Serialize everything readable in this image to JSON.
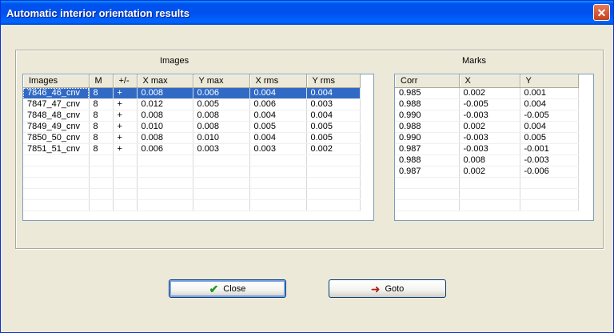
{
  "window": {
    "title": "Automatic interior orientation results",
    "close_glyph": "✕"
  },
  "images_panel": {
    "label": "Images",
    "columns": [
      "Images",
      "M",
      "+/-",
      "X max",
      "Y max",
      "X rms",
      "Y rms"
    ],
    "rows": [
      [
        "7846_46_cnv",
        "8",
        "+",
        "0.008",
        "0.006",
        "0.004",
        "0.004"
      ],
      [
        "7847_47_cnv",
        "8",
        "+",
        "0.012",
        "0.005",
        "0.006",
        "0.003"
      ],
      [
        "7848_48_cnv",
        "8",
        "+",
        "0.008",
        "0.008",
        "0.004",
        "0.004"
      ],
      [
        "7849_49_cnv",
        "8",
        "+",
        "0.010",
        "0.008",
        "0.005",
        "0.005"
      ],
      [
        "7850_50_cnv",
        "8",
        "+",
        "0.008",
        "0.010",
        "0.004",
        "0.005"
      ],
      [
        "7851_51_cnv",
        "8",
        "+",
        "0.006",
        "0.003",
        "0.003",
        "0.002"
      ]
    ],
    "selected_row": 0
  },
  "marks_panel": {
    "label": "Marks",
    "columns": [
      "Corr",
      "X",
      "Y"
    ],
    "rows": [
      [
        "0.985",
        "0.002",
        "0.001"
      ],
      [
        "0.988",
        "-0.005",
        "0.004"
      ],
      [
        "0.990",
        "-0.003",
        "-0.005"
      ],
      [
        "0.988",
        "0.002",
        "0.004"
      ],
      [
        "0.990",
        "-0.003",
        "0.005"
      ],
      [
        "0.987",
        "-0.003",
        "-0.001"
      ],
      [
        "0.988",
        "0.008",
        "-0.003"
      ],
      [
        "0.987",
        "0.002",
        "-0.006"
      ]
    ]
  },
  "buttons": {
    "close": {
      "label": "Close",
      "icon": "checkmark-icon"
    },
    "goto": {
      "label": "Goto",
      "icon": "arrow-right-icon"
    }
  },
  "colors": {
    "title_bar": "#0053ee",
    "selection": "#316ac5",
    "face": "#ece9d8"
  }
}
